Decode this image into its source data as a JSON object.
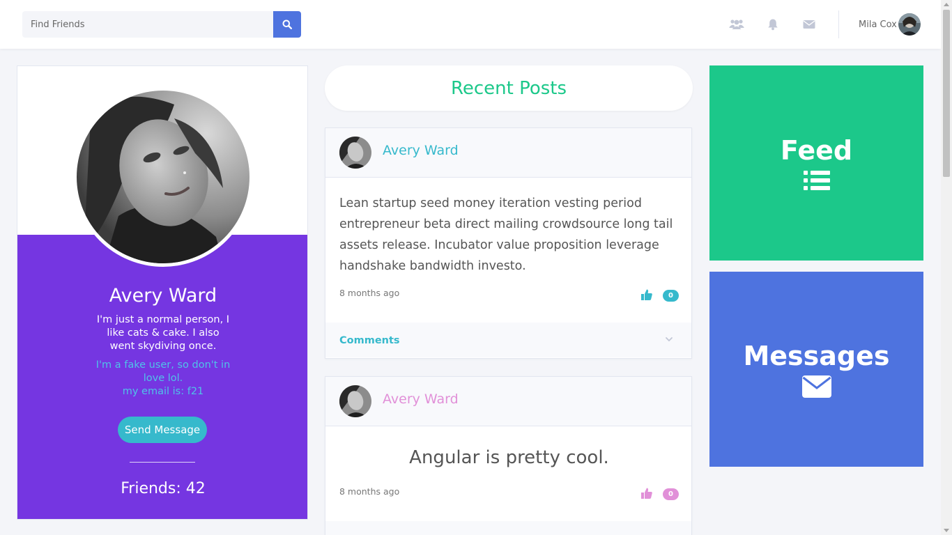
{
  "header": {
    "search_placeholder": "Find Friends",
    "user_name": "Mila Cox"
  },
  "profile": {
    "name": "Avery Ward",
    "bio": "I'm just a normal person, I like cats & cake. I also went skydiving once.",
    "note_line1": "I'm a fake user, so don't in love lol.",
    "note_line2": "my email is: f21",
    "send_label": "Send Message",
    "friends": "Friends: 42"
  },
  "feed_title": "Recent Posts",
  "posts": [
    {
      "author": "Avery Ward",
      "text": "Lean startup seed money iteration vesting period entrepreneur beta direct mailing crowdsource long tail assets release. Incubator value proposition leverage handshake bandwidth investo.",
      "time": "8 months ago",
      "likes": "0",
      "comments_label": "Comments",
      "accent": "#36b9cc"
    },
    {
      "author": "Avery Ward",
      "text": "Angular is pretty cool.",
      "time": "8 months ago",
      "likes": "0",
      "accent": "#e190d8"
    }
  ],
  "tiles": {
    "feed": "Feed",
    "messages": "Messages"
  },
  "colors": {
    "primary": "#4e73df",
    "success": "#1cc88a",
    "info": "#36b9cc",
    "purple": "#7536e1",
    "pink": "#e190d8"
  },
  "icons": {
    "search": "search-icon",
    "friends": "users-icon",
    "notifications": "bell-icon",
    "messages": "envelope-icon",
    "like": "thumbs-up-icon",
    "feed": "list-icon"
  }
}
